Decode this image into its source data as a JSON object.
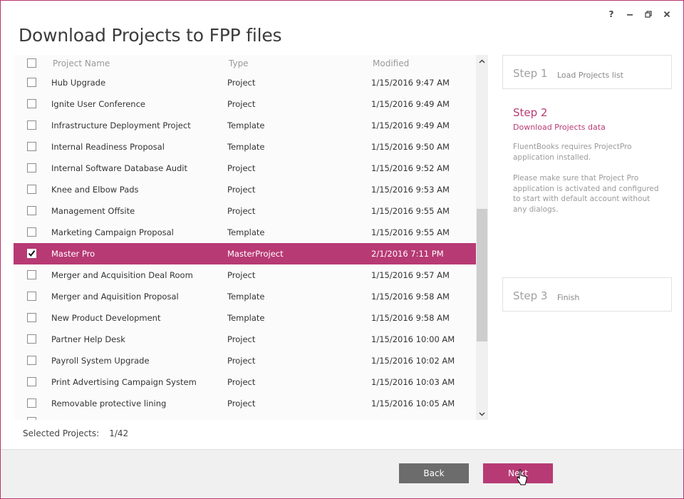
{
  "window": {
    "title": "Download Projects to FPP files",
    "controls": [
      "help-icon",
      "minimize-icon",
      "restore-icon",
      "close-icon"
    ],
    "help_label": "?"
  },
  "list": {
    "headers": {
      "name": "Project Name",
      "type": "Type",
      "modified": "Modified"
    },
    "rows": [
      {
        "name": "Hub Upgrade",
        "type": "Project",
        "modified": "1/15/2016 9:47 AM",
        "checked": false
      },
      {
        "name": "Ignite User Conference",
        "type": "Project",
        "modified": "1/15/2016 9:49 AM",
        "checked": false
      },
      {
        "name": "Infrastructure Deployment Project",
        "type": "Template",
        "modified": "1/15/2016 9:49 AM",
        "checked": false
      },
      {
        "name": "Internal Readiness Proposal",
        "type": "Template",
        "modified": "1/15/2016 9:50 AM",
        "checked": false
      },
      {
        "name": "Internal Software Database Audit",
        "type": "Project",
        "modified": "1/15/2016 9:52 AM",
        "checked": false
      },
      {
        "name": "Knee and Elbow Pads",
        "type": "Project",
        "modified": "1/15/2016 9:53 AM",
        "checked": false
      },
      {
        "name": "Management Offsite",
        "type": "Project",
        "modified": "1/15/2016 9:55 AM",
        "checked": false
      },
      {
        "name": "Marketing Campaign Proposal",
        "type": "Template",
        "modified": "1/15/2016 9:55 AM",
        "checked": false
      },
      {
        "name": "Master Pro",
        "type": "MasterProject",
        "modified": "2/1/2016 7:11 PM",
        "checked": true
      },
      {
        "name": "Merger and Acquisition Deal Room",
        "type": "Project",
        "modified": "1/15/2016 9:57 AM",
        "checked": false
      },
      {
        "name": "Merger and Aquisition Proposal",
        "type": "Template",
        "modified": "1/15/2016 9:58 AM",
        "checked": false
      },
      {
        "name": "New Product Development",
        "type": "Template",
        "modified": "1/15/2016 9:58 AM",
        "checked": false
      },
      {
        "name": "Partner Help Desk",
        "type": "Project",
        "modified": "1/15/2016 10:00 AM",
        "checked": false
      },
      {
        "name": "Payroll System Upgrade",
        "type": "Project",
        "modified": "1/15/2016 10:02 AM",
        "checked": false
      },
      {
        "name": "Print Advertising Campaign System",
        "type": "Project",
        "modified": "1/15/2016 10:03 AM",
        "checked": false
      },
      {
        "name": "Removable protective lining",
        "type": "Project",
        "modified": "1/15/2016 10:05 AM",
        "checked": false
      }
    ]
  },
  "selection": {
    "label": "Selected Projects:",
    "value": "1/42"
  },
  "steps": {
    "step1": {
      "num": "Step 1",
      "label": "Load Projects list"
    },
    "step2": {
      "num": "Step 2",
      "label": "Download Projects data",
      "desc1": "FluentBooks requires ProjectPro application installed.",
      "desc2": "Please make sure that Project Pro application is activated and configured to start with default account without any dialogs."
    },
    "step3": {
      "num": "Step 3",
      "label": "Finish"
    }
  },
  "buttons": {
    "back": "Back",
    "next": "Next"
  },
  "colors": {
    "accent": "#b73a74",
    "back_button": "#6c6c6c",
    "footer_bg": "#f0f0f0"
  }
}
